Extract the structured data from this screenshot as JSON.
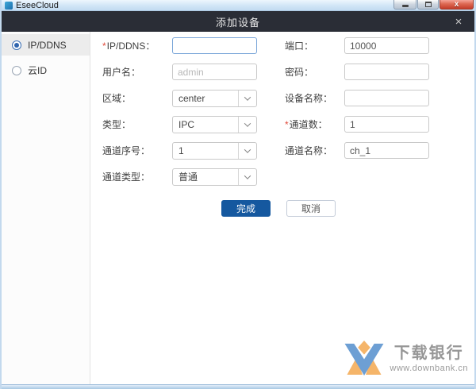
{
  "window": {
    "title": "EseeCloud"
  },
  "dialog": {
    "title": "添加设备",
    "close_glyph": "×"
  },
  "sidebar": {
    "items": [
      {
        "label": "IP/DDNS",
        "selected": true
      },
      {
        "label": "云ID",
        "selected": false
      }
    ]
  },
  "form": {
    "rows": [
      {
        "left": {
          "star": "*",
          "label": "IP/DDNS：",
          "control": {
            "kind": "input",
            "value": "",
            "focused": true
          }
        },
        "right": {
          "label": "端口：",
          "control": {
            "kind": "input",
            "value": "10000"
          }
        }
      },
      {
        "left": {
          "label": "用户名：",
          "control": {
            "kind": "input",
            "value": "",
            "placeholder": "admin"
          }
        },
        "right": {
          "label": "密码：",
          "control": {
            "kind": "input",
            "value": ""
          }
        }
      },
      {
        "left": {
          "label": "区域：",
          "control": {
            "kind": "select",
            "value": "center"
          }
        },
        "right": {
          "label": "设备名称：",
          "control": {
            "kind": "input",
            "value": ""
          }
        }
      },
      {
        "left": {
          "label": "类型：",
          "control": {
            "kind": "select",
            "value": "IPC"
          }
        },
        "right": {
          "star": "*",
          "label": "通道数：",
          "control": {
            "kind": "input",
            "value": "1"
          }
        }
      },
      {
        "left": {
          "label": "通道序号：",
          "control": {
            "kind": "select",
            "value": "1"
          }
        },
        "right": {
          "label": "通道名称：",
          "control": {
            "kind": "input",
            "value": "ch_1"
          }
        }
      },
      {
        "left": {
          "label": "通道类型：",
          "control": {
            "kind": "select",
            "value": "普通"
          }
        }
      }
    ],
    "buttons": {
      "ok": "完成",
      "cancel": "取消"
    }
  },
  "watermark": {
    "name": "下载银行",
    "url": "www.downbank.cn"
  },
  "colors": {
    "accent_blue": "#15589f",
    "header_dark": "#2a2d36",
    "required_red": "#e04b3c",
    "logo_blue": "#6d9fd4",
    "logo_orange": "#f5b56a"
  }
}
